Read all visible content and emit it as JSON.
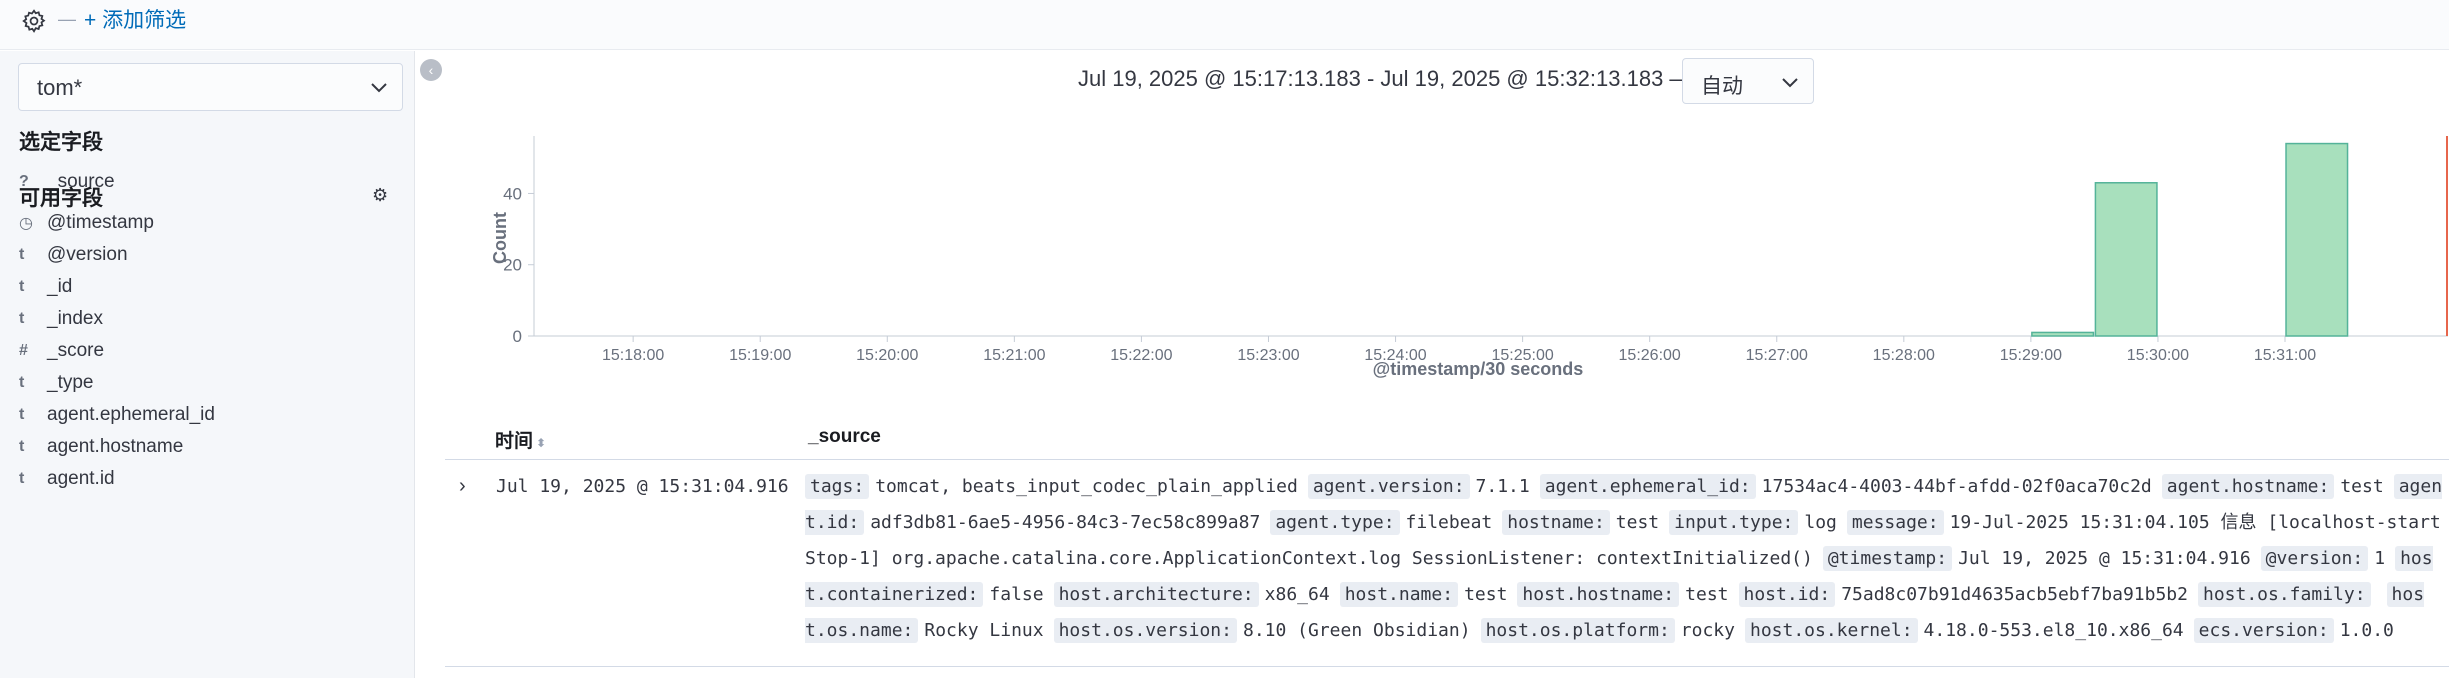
{
  "filter_bar": {
    "separator": "—",
    "add_filter_label": "+ 添加筛选",
    "gear_icon": "gear-icon"
  },
  "sidebar": {
    "index_pattern": "tom*",
    "selected_fields_title": "选定字段",
    "selected_fields": [
      {
        "type": "?",
        "name": "_source"
      }
    ],
    "available_fields_title": "可用字段",
    "available_fields": [
      {
        "type": "◷",
        "name": "@timestamp"
      },
      {
        "type": "t",
        "name": "@version"
      },
      {
        "type": "t",
        "name": "_id"
      },
      {
        "type": "t",
        "name": "_index"
      },
      {
        "type": "#",
        "name": "_score"
      },
      {
        "type": "t",
        "name": "_type"
      },
      {
        "type": "t",
        "name": "agent.ephemeral_id"
      },
      {
        "type": "t",
        "name": "agent.hostname"
      },
      {
        "type": "t",
        "name": "agent.id"
      }
    ]
  },
  "time_range": {
    "text": "Jul 19, 2025 @ 15:17:13.183 - Jul 19, 2025 @ 15:32:13.183 —",
    "interval": "自动"
  },
  "colors": {
    "bar_fill": "#a8e0bd",
    "bar_stroke": "#54b399",
    "now_line": "#e7664c",
    "link": "#006bb8"
  },
  "chart_data": {
    "type": "bar",
    "ylabel": "Count",
    "xlabel": "@timestamp/30 seconds",
    "yticks": [
      0,
      20,
      40
    ],
    "ylim": [
      0,
      55
    ],
    "xticks": [
      "15:18:00",
      "15:19:00",
      "15:20:00",
      "15:21:00",
      "15:22:00",
      "15:23:00",
      "15:24:00",
      "15:25:00",
      "15:26:00",
      "15:27:00",
      "15:28:00",
      "15:29:00",
      "15:30:00",
      "15:31:00"
    ],
    "bars": [
      {
        "start": "15:29:00",
        "value": 1
      },
      {
        "start": "15:29:30",
        "value": 43
      },
      {
        "start": "15:31:00",
        "value": 54
      }
    ]
  },
  "table": {
    "col_time": "时间",
    "col_source": "_source",
    "rows": [
      {
        "time": "Jul 19, 2025 @ 15:31:04.916",
        "fields": [
          {
            "k": "tags:",
            "v": "tomcat, beats_input_codec_plain_applied"
          },
          {
            "k": "agent.version:",
            "v": "7.1.1"
          },
          {
            "k": "agent.ephemeral_id:",
            "v": "17534ac4-4003-44bf-afdd-02f0aca70c2d"
          },
          {
            "k": "agent.hostname:",
            "v": "test"
          },
          {
            "k": "agent.id:",
            "v": "adf3db81-6ae5-4956-84c3-7ec58c899a87"
          },
          {
            "k": "agent.type:",
            "v": "filebeat"
          },
          {
            "k": "hostname:",
            "v": "test"
          },
          {
            "k": "input.type:",
            "v": "log"
          },
          {
            "k": "message:",
            "v": "19-Jul-2025 15:31:04.105 信息 [localhost-startStop-1] org.apache.catalina.core.ApplicationContext.log SessionListener: contextInitialized()"
          },
          {
            "k": "@timestamp:",
            "v": "Jul 19, 2025 @ 15:31:04.916"
          },
          {
            "k": "@version:",
            "v": "1"
          },
          {
            "k": "host.containerized:",
            "v": "false"
          },
          {
            "k": "host.architecture:",
            "v": "x86_64"
          },
          {
            "k": "host.name:",
            "v": "test"
          },
          {
            "k": "host.hostname:",
            "v": "test"
          },
          {
            "k": "host.id:",
            "v": "75ad8c07b91d4635acb5ebf7ba91b5b2"
          },
          {
            "k": "host.os.family:",
            "v": ""
          },
          {
            "k": "host.os.name:",
            "v": "Rocky Linux"
          },
          {
            "k": "host.os.version:",
            "v": "8.10 (Green Obsidian)"
          },
          {
            "k": "host.os.platform:",
            "v": "rocky"
          },
          {
            "k": "host.os.kernel:",
            "v": "4.18.0-553.el8_10.x86_64"
          },
          {
            "k": "ecs.version:",
            "v": "1.0.0"
          }
        ]
      }
    ]
  }
}
